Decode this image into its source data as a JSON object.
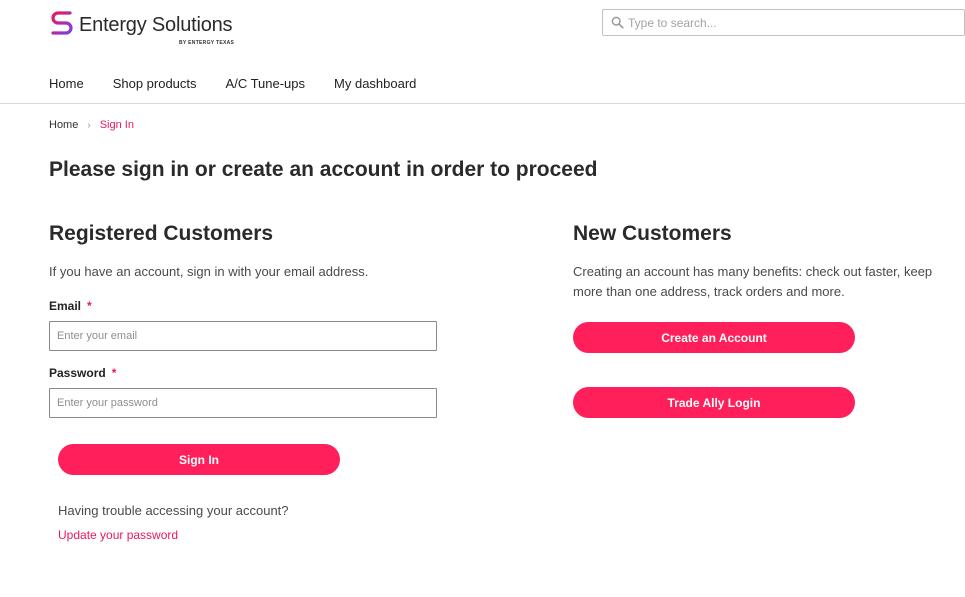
{
  "brand": {
    "name": "Entergy Solutions",
    "subtitle": "BY ENTERGY TEXAS",
    "accent_color": "#ff1f5a",
    "logo_gradient": [
      "#e8195a",
      "#7b3fe4"
    ]
  },
  "search": {
    "placeholder": "Type to search...",
    "icon": "search-icon"
  },
  "nav": {
    "items": [
      {
        "label": "Home"
      },
      {
        "label": "Shop products"
      },
      {
        "label": "A/C Tune-ups"
      },
      {
        "label": "My dashboard"
      }
    ]
  },
  "breadcrumb": {
    "home": "Home",
    "separator": "›",
    "current": "Sign In"
  },
  "page": {
    "title": "Please sign in or create an account in order to proceed"
  },
  "registered": {
    "title": "Registered Customers",
    "description": "If you have an account, sign in with your email address.",
    "email_label": "Email",
    "email_placeholder": "Enter your email",
    "password_label": "Password",
    "password_placeholder": "Enter your password",
    "required_mark": "*",
    "sign_in_label": "Sign In",
    "trouble_text": "Having trouble accessing your account?",
    "update_password_label": "Update your password"
  },
  "new_customers": {
    "title": "New Customers",
    "description": "Creating an account has many benefits: check out faster, keep more than one address, track orders and more.",
    "create_account_label": "Create an Account",
    "trade_ally_label": "Trade Ally Login"
  }
}
